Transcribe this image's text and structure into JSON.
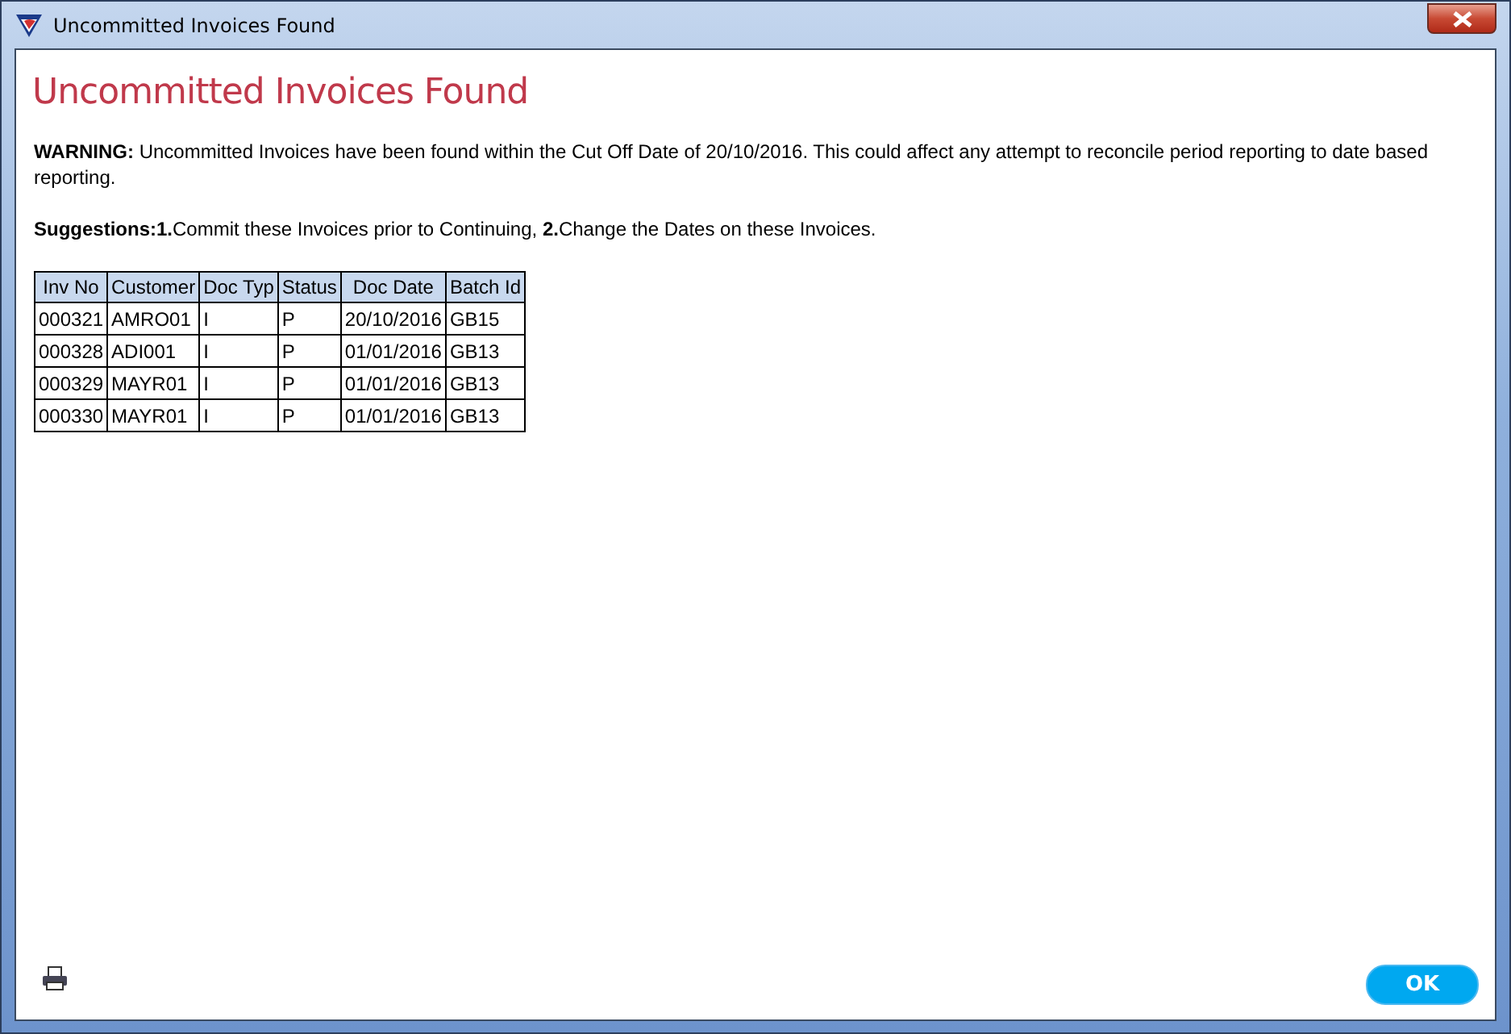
{
  "window": {
    "title": "Uncommitted Invoices Found"
  },
  "heading": "Uncommitted Invoices Found",
  "warning": "**WARNING:** Uncommitted Invoices have been found within the Cut Off Date of 20/10/2016. This could affect any attempt to reconcile period reporting to date based reporting.",
  "suggestions": "**Suggestions:1.**Commit these Invoices prior to Continuing, **2.**Change the Dates on these Invoices.",
  "table": {
    "columns": [
      "Inv No",
      "Customer",
      "Doc Typ",
      "Status",
      "Doc Date",
      "Batch Id"
    ],
    "rows": [
      [
        "000321",
        "AMRO01",
        "I",
        "P",
        "20/10/2016",
        "GB15"
      ],
      [
        "000328",
        "ADI001",
        "I",
        "P",
        "01/01/2016",
        "GB13"
      ],
      [
        "000329",
        "MAYR01",
        "I",
        "P",
        "01/01/2016",
        "GB13"
      ],
      [
        "000330",
        "MAYR01",
        "I",
        "P",
        "01/01/2016",
        "GB13"
      ]
    ]
  },
  "buttons": [
    "OK"
  ]
}
